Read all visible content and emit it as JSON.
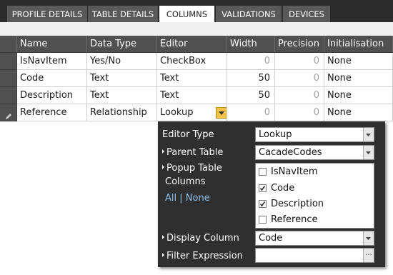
{
  "tabs": [
    {
      "label": "PROFILE DETAILS",
      "active": false
    },
    {
      "label": "TABLE DETAILS",
      "active": false
    },
    {
      "label": "COLUMNS",
      "active": true
    },
    {
      "label": "VALIDATIONS",
      "active": false
    },
    {
      "label": "DEVICES",
      "active": false
    }
  ],
  "grid": {
    "headers": [
      "Name",
      "Data Type",
      "Editor",
      "Width",
      "Precision",
      "Initialisation"
    ],
    "rows": [
      {
        "name": "IsNavItem",
        "data_type": "Yes/No",
        "editor": "CheckBox",
        "width": "0",
        "precision": "0",
        "initialisation": "None"
      },
      {
        "name": "Code",
        "data_type": "Text",
        "editor": "Text",
        "width": "50",
        "precision": "0",
        "initialisation": "None"
      },
      {
        "name": "Description",
        "data_type": "Text",
        "editor": "Text",
        "width": "50",
        "precision": "0",
        "initialisation": "None"
      },
      {
        "name": "Reference",
        "data_type": "Relationship",
        "editor": "Lookup",
        "width": "0",
        "precision": "0",
        "initialisation": "None"
      }
    ],
    "edit_row_icon": "pencil-icon"
  },
  "editor_panel": {
    "editor_type_label": "Editor Type",
    "editor_type_value": "Lookup",
    "parent_table_label": "Parent Table",
    "parent_table_value": "CacadeCodes",
    "popup_columns_label_line1": "Popup Table",
    "popup_columns_label_line2": "Columns",
    "all_link": "All",
    "link_separator": "|",
    "none_link": "None",
    "popup_columns": [
      {
        "label": "IsNavItem",
        "checked": false
      },
      {
        "label": "Code",
        "checked": true
      },
      {
        "label": "Description",
        "checked": true
      },
      {
        "label": "Reference",
        "checked": false
      }
    ],
    "display_column_label": "Display Column",
    "display_column_value": "Code",
    "filter_expression_label": "Filter Expression",
    "filter_expression_value": "",
    "ellipsis_button": "..."
  },
  "colors": {
    "tabbar_bg": "#2c2c2c",
    "tab_bg": "#595959",
    "header_bg": "#505050",
    "panel_bg": "#2f2f2f",
    "dropdown_button": "#f6c244",
    "link": "#8fbfe8"
  }
}
